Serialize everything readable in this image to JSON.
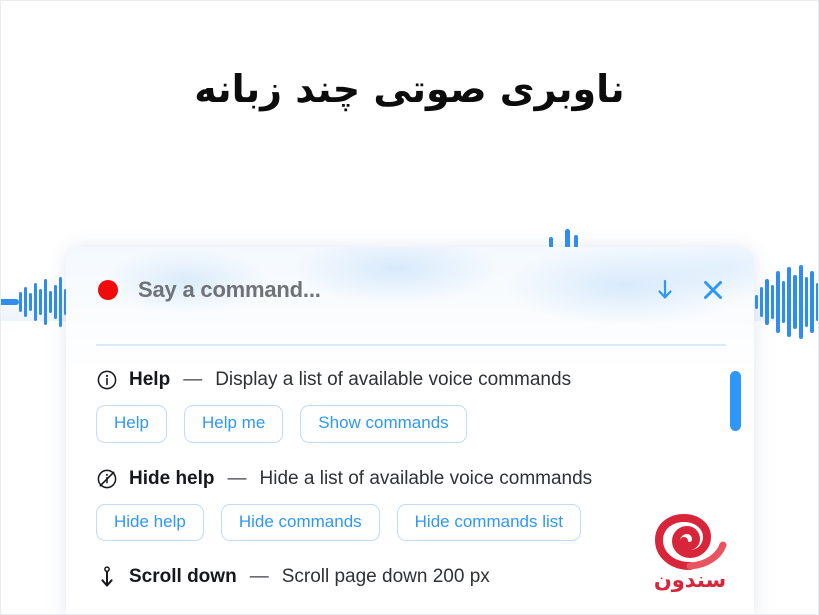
{
  "page": {
    "title": "ناوبری صوتی چند زبانه"
  },
  "colors": {
    "accent_blue": "#2f97f7",
    "record_red": "#f00a0a",
    "logo_red": "#d9253a",
    "divider": "#d7e9fb",
    "chip_border": "#bfdcf8"
  },
  "panel": {
    "record_indicator": "record-dot",
    "prompt": "Say a command...",
    "actions": [
      {
        "name": "download-icon",
        "label": "Download"
      },
      {
        "name": "close-icon",
        "label": "Close"
      }
    ],
    "commands": [
      {
        "icon": "info-circle-icon",
        "name": "Help",
        "dash": "—",
        "description": "Display a list of available voice commands",
        "chips": [
          "Help",
          "Help me",
          "Show commands"
        ]
      },
      {
        "icon": "info-circle-slash-icon",
        "name": "Hide help",
        "dash": "—",
        "description": "Hide a list of available voice commands",
        "chips": [
          "Hide help",
          "Hide commands",
          "Hide commands list"
        ]
      },
      {
        "icon": "arrow-down-anchor-icon",
        "name": "Scroll down",
        "dash": "—",
        "description": "Scroll page down 200 px",
        "chips": []
      }
    ]
  },
  "logo": {
    "mark": "spiral-logo-icon",
    "word": "سندون"
  }
}
